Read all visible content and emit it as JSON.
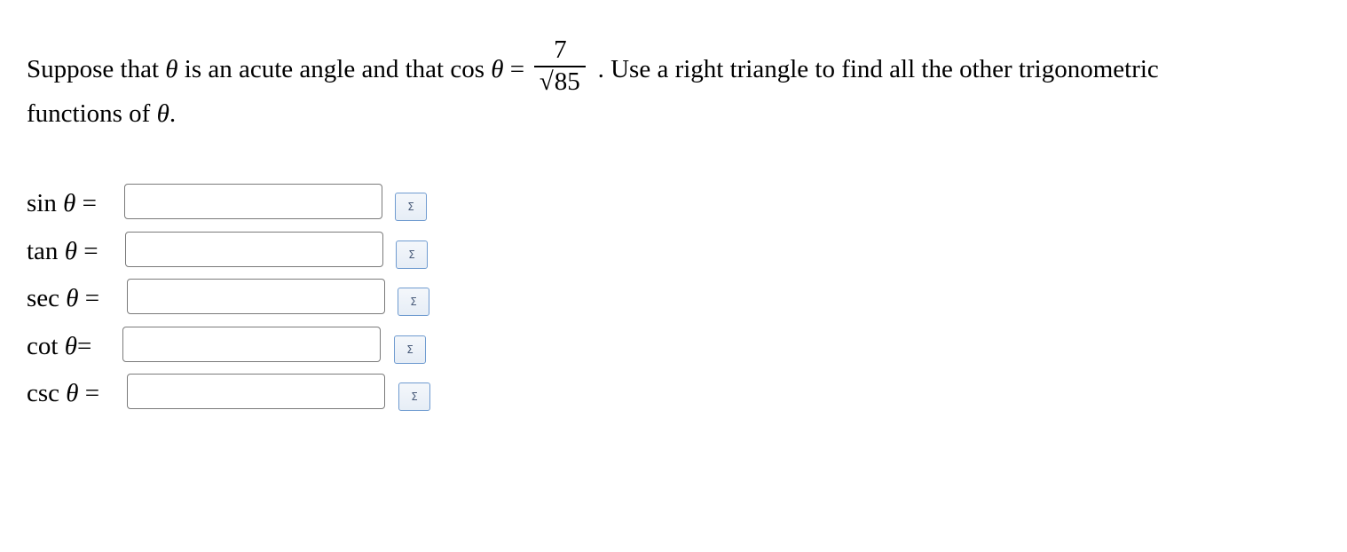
{
  "problem": {
    "line1_before": "Suppose that ",
    "theta": "θ",
    "line1_mid": " is an acute angle and that cos ",
    "equals": " = ",
    "cos_numerator": "7",
    "sqrt_symbol": "√",
    "cos_denominator_radicand": "85",
    "line1_after": " . Use a right triangle to find all the other trigonometric",
    "line2_before": "functions of ",
    "line2_after": "."
  },
  "rows": [
    {
      "func": "sin",
      "theta": "θ",
      "equals": "=",
      "value": "",
      "sigma": "Σ"
    },
    {
      "func": "tan",
      "theta": "θ",
      "equals": "=",
      "value": "",
      "sigma": "Σ"
    },
    {
      "func": "sec",
      "theta": "θ",
      "equals": "=",
      "value": "",
      "sigma": "Σ"
    },
    {
      "func": "cot",
      "theta": "θ",
      "equals": "=",
      "value": "",
      "sigma": "Σ"
    },
    {
      "func": "csc",
      "theta": "θ",
      "equals": "=",
      "value": "",
      "sigma": "Σ"
    }
  ],
  "icons": {
    "sigma_button": "sigma-icon"
  },
  "colors": {
    "input_border": "#7a7a7a",
    "sigma_border": "#6f9bd0",
    "sigma_bg": "#eef3f9"
  }
}
